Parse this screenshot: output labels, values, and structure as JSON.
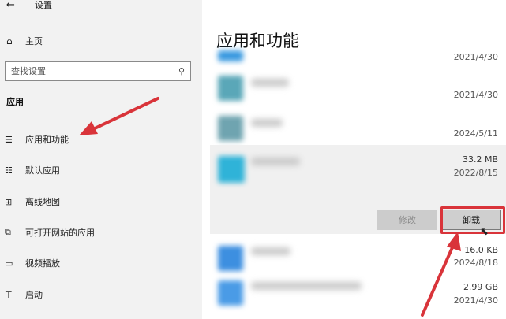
{
  "window": {
    "back_glyph": "←",
    "title": "设置"
  },
  "sidebar": {
    "home": {
      "icon": "home-icon",
      "glyph": "⌂",
      "label": "主页"
    },
    "search": {
      "placeholder": "查找设置",
      "icon": "search-icon",
      "glyph": "⚲"
    },
    "section_title": "应用",
    "items": [
      {
        "label": "应用和功能",
        "icon": "apps-features-icon",
        "glyph": "☰"
      },
      {
        "label": "默认应用",
        "icon": "default-apps-icon",
        "glyph": "☷"
      },
      {
        "label": "离线地图",
        "icon": "offline-maps-icon",
        "glyph": "⊞"
      },
      {
        "label": "可打开网站的应用",
        "icon": "apps-for-websites-icon",
        "glyph": "⧉"
      },
      {
        "label": "视频播放",
        "icon": "video-playback-icon",
        "glyph": "▭"
      },
      {
        "label": "启动",
        "icon": "startup-icon",
        "glyph": "⊤"
      }
    ]
  },
  "main": {
    "title": "应用和功能",
    "apps": [
      {
        "size": "",
        "date": "2021/4/30"
      },
      {
        "size": "",
        "date": "2021/4/30"
      },
      {
        "size": "",
        "date": "2024/5/11"
      },
      {
        "size": "33.2 MB",
        "date": "2022/8/15"
      },
      {
        "size": "16.0 KB",
        "date": "2024/8/18"
      },
      {
        "size": "2.99 GB",
        "date": "2021/4/30"
      }
    ],
    "buttons": {
      "modify": "修改",
      "uninstall": "卸载"
    }
  },
  "colors": {
    "annotation_red": "#d9343a",
    "sidebar_bg": "#f2f2f2",
    "selected_bg": "#f0f0f0"
  }
}
